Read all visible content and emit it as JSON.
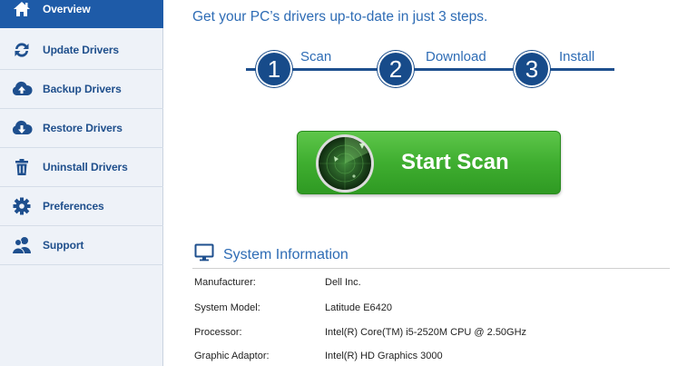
{
  "sidebar": {
    "items": [
      {
        "label": "Overview",
        "icon": "home-icon",
        "active": true
      },
      {
        "label": "Update Drivers",
        "icon": "refresh-icon",
        "active": false
      },
      {
        "label": "Backup Drivers",
        "icon": "cloud-upload-icon",
        "active": false
      },
      {
        "label": "Restore Drivers",
        "icon": "cloud-download-icon",
        "active": false
      },
      {
        "label": "Uninstall Drivers",
        "icon": "trash-icon",
        "active": false
      },
      {
        "label": "Preferences",
        "icon": "gear-icon",
        "active": false
      },
      {
        "label": "Support",
        "icon": "users-icon",
        "active": false
      }
    ]
  },
  "main": {
    "headline": "Get your PC’s drivers up-to-date in just 3 steps.",
    "steps": [
      {
        "number": "1",
        "label": "Scan"
      },
      {
        "number": "2",
        "label": "Download"
      },
      {
        "number": "3",
        "label": "Install"
      }
    ],
    "scan_button": {
      "label": "Start Scan",
      "icon": "radar-icon"
    },
    "system_info": {
      "title": "System Information",
      "icon": "monitor-icon",
      "rows": [
        {
          "key": "Manufacturer:",
          "value": "Dell Inc."
        },
        {
          "key": "System Model:",
          "value": "Latitude E6420"
        },
        {
          "key": "Processor:",
          "value": "Intel(R) Core(TM) i5-2520M CPU @ 2.50GHz"
        },
        {
          "key": "Graphic Adaptor:",
          "value": "Intel(R) HD Graphics 3000"
        }
      ]
    }
  },
  "colors": {
    "accent": "#1e5ba8",
    "text_blue": "#2e6cb5",
    "step_blue": "#174b8a",
    "scan_green": "#3fae30"
  }
}
